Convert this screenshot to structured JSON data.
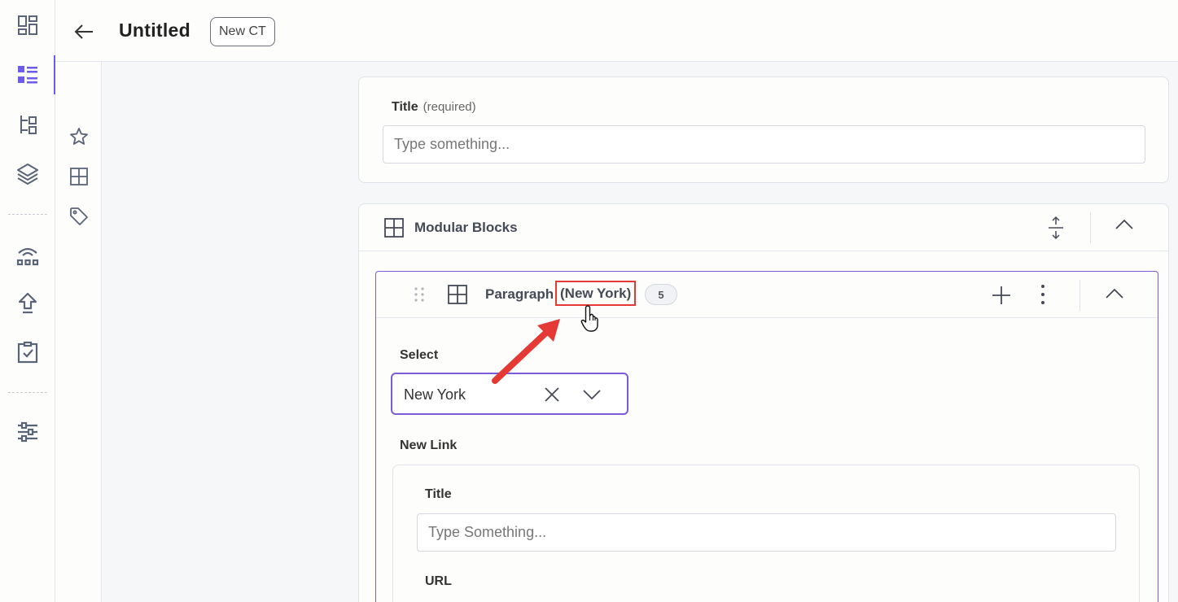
{
  "header": {
    "title": "Untitled",
    "content_type_badge": "New CT"
  },
  "icons": {
    "rail": [
      "dashboard-icon",
      "entries-icon",
      "content-models-icon",
      "assets-icon",
      "releases-icon",
      "deploy-icon",
      "tasks-icon",
      "settings-icon"
    ],
    "rail2": [
      "star-icon",
      "grid-icon",
      "tag-icon"
    ],
    "accent_color": "#6c5ce7",
    "annotation_color": "#e53935"
  },
  "title_field": {
    "label": "Title",
    "required_note": "(required)",
    "placeholder": "Type something..."
  },
  "modular_blocks": {
    "label": "Modular Blocks",
    "block": {
      "name": "Paragraph",
      "subtitle": "(New York)",
      "count": "5",
      "select": {
        "label": "Select",
        "value": "New York"
      },
      "link_group": {
        "label": "New Link",
        "title_label": "Title",
        "title_placeholder": "Type Something...",
        "url_label": "URL"
      }
    }
  }
}
